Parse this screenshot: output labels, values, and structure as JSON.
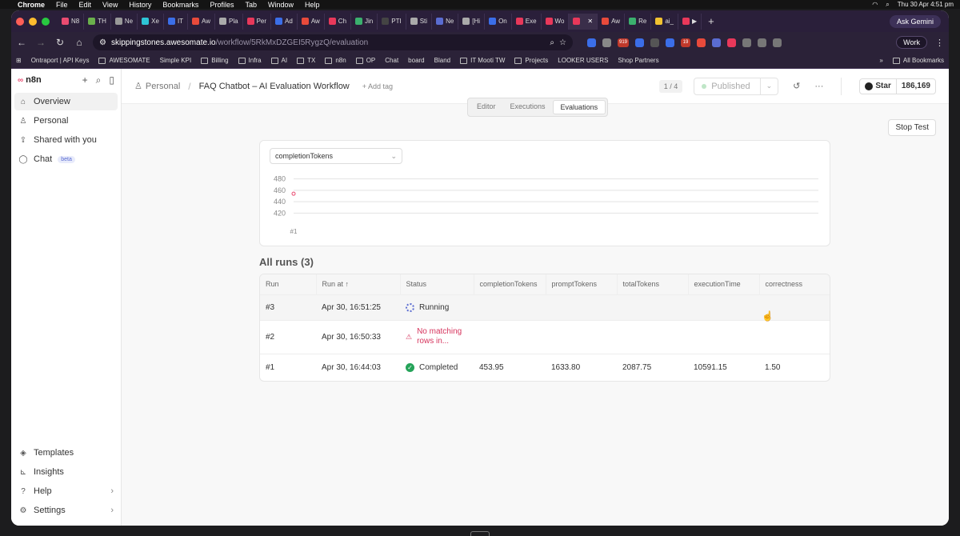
{
  "menubar": {
    "app": "Chrome",
    "items": [
      "File",
      "Edit",
      "View",
      "History",
      "Bookmarks",
      "Profiles",
      "Tab",
      "Window",
      "Help"
    ],
    "datetime": "Thu 30 Apr 4:51 pm"
  },
  "browser": {
    "tabs": [
      "N8",
      "TH",
      "Ne",
      "Xe",
      "IT",
      "Aw",
      "Pla",
      "Per",
      "Ad",
      "Aw",
      "Ch",
      "Jin",
      "PTI",
      "Sti",
      "Ne",
      "[Hi",
      "On",
      "Exe",
      "Wo",
      "",
      "Aw",
      "Re",
      "ai_",
      "▶"
    ],
    "ask_gemini": "Ask Gemini",
    "url_host": "skippingstones.awesomate.io",
    "url_path": "/workflow/5RkMxDZGEI5RygzQ/evaluation",
    "ext_badges": [
      "919",
      "19"
    ],
    "profile": "Work",
    "bookmarks": [
      "Ontraport | API Keys",
      "AWESOMATE",
      "Simple KPI",
      "Billing",
      "Infra",
      "AI",
      "TX",
      "n8n",
      "OP",
      "Chat",
      "board",
      "Bland",
      "IT Mooti TW",
      "Projects",
      "LOOKER USERS",
      "Shop Partners"
    ],
    "all_bookmarks": "All Bookmarks"
  },
  "sidebar": {
    "brand": "n8n",
    "items": [
      {
        "label": "Overview"
      },
      {
        "label": "Personal"
      },
      {
        "label": "Shared with you"
      },
      {
        "label": "Chat",
        "badge": "beta"
      }
    ],
    "bottom": [
      "Templates",
      "Insights",
      "Help",
      "Settings"
    ]
  },
  "header": {
    "breadcrumb_root": "Personal",
    "workflow_title": "FAQ Chatbot – AI Evaluation Workflow",
    "add_tag": "+ Add tag",
    "pager": "1 / 4",
    "published": "Published",
    "github_star": "Star",
    "github_count": "186,169",
    "tabs": [
      "Editor",
      "Executions",
      "Evaluations"
    ],
    "active_tab": "Evaluations"
  },
  "stop_test": "Stop Test",
  "metric_select": "completionTokens",
  "chart_data": {
    "type": "scatter",
    "categories": [
      "#1"
    ],
    "values": [
      453.95
    ],
    "yticks": [
      480,
      460,
      440,
      420
    ],
    "ylim": [
      415,
      485
    ],
    "point_color": "#ea4b71"
  },
  "runs": {
    "title": "All runs (3)",
    "columns": [
      "Run",
      "Run at ↑",
      "Status",
      "completionTokens",
      "promptTokens",
      "totalTokens",
      "executionTime",
      "correctness"
    ],
    "rows": [
      {
        "run": "#3",
        "run_at": "Apr 30, 16:51:25",
        "status": "Running",
        "completionTokens": "",
        "promptTokens": "",
        "totalTokens": "",
        "executionTime": "",
        "correctness": ""
      },
      {
        "run": "#2",
        "run_at": "Apr 30, 16:50:33",
        "status": "No matching rows in...",
        "completionTokens": "",
        "promptTokens": "",
        "totalTokens": "",
        "executionTime": "",
        "correctness": ""
      },
      {
        "run": "#1",
        "run_at": "Apr 30, 16:44:03",
        "status": "Completed",
        "completionTokens": "453.95",
        "promptTokens": "1633.80",
        "totalTokens": "2087.75",
        "executionTime": "10591.15",
        "correctness": "1.50"
      }
    ]
  }
}
